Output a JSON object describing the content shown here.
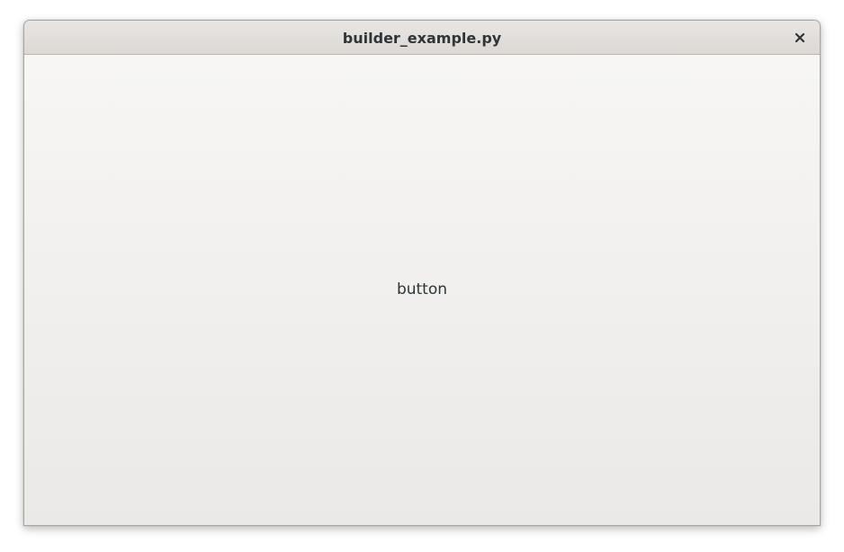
{
  "window": {
    "title": "builder_example.py",
    "close_icon": "close-icon"
  },
  "content": {
    "button_label": "button"
  },
  "colors": {
    "titlebar": "#dedad6",
    "content_background": "#f2f1ef",
    "text": "#2e3436",
    "border": "#a9a6a1"
  }
}
